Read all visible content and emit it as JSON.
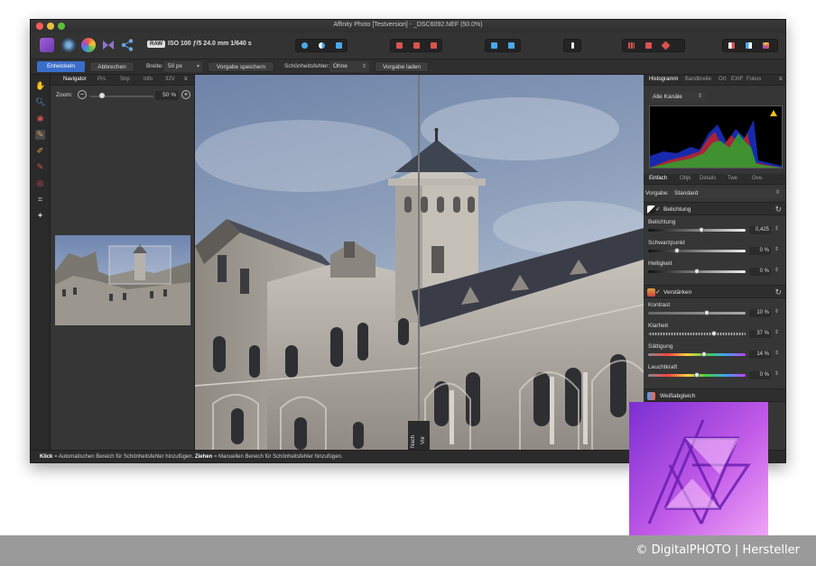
{
  "window": {
    "title": "Affinity Photo [Testversion] - _DSC6092.NEF (50.0%)"
  },
  "toolbar": {
    "raw_badge": "RAW",
    "camera_info": "ISO 100 ƒ/5 24.0 mm 1/640 s"
  },
  "context_bar": {
    "develop_label": "Entwickeln",
    "cancel_label": "Abbrechen",
    "width_label": "Breite:",
    "width_value": "50 px",
    "save_preset_label": "Vorgabe speichern",
    "blemish_label": "Schönheitsfehler:",
    "blemish_value": "Ohne",
    "load_preset_label": "Vorgabe laden"
  },
  "navigator": {
    "tabs": [
      "Navigator",
      "Prs",
      "Snp",
      "Info",
      "32V"
    ],
    "zoom_label": "Zoom:",
    "zoom_value": "50 %",
    "zoom_level": 0.5
  },
  "canvas": {
    "split_after": "Nach",
    "split_before": "Vor"
  },
  "right_panel": {
    "top_tabs": [
      "Histogramm",
      "Bandbreite",
      "Ort",
      "EXIF",
      "Fokus"
    ],
    "channel_select": "Alle Kanäle",
    "adjust_tabs": [
      "Einfach",
      "Objk",
      "Details",
      "Twe",
      "Ove."
    ],
    "preset_label": "Vorgabe:",
    "preset_value": "Standard",
    "sections": [
      {
        "name": "Belichtung",
        "sliders": [
          {
            "label": "Belichtung",
            "value": "0,425",
            "level": 0.55
          },
          {
            "label": "Schwarzpunkt",
            "value": "0 %",
            "level": 0.3
          },
          {
            "label": "Helligkeit",
            "value": "0 %",
            "level": 0.5
          }
        ]
      },
      {
        "name": "Verstärken",
        "sliders": [
          {
            "label": "Kontrast",
            "value": "10 %",
            "level": 0.6
          },
          {
            "label": "Klarheit",
            "value": "37 %",
            "level": 0.68
          },
          {
            "label": "Sättigung",
            "value": "14 %",
            "level": 0.57
          },
          {
            "label": "Leuchtkraft",
            "value": "0 %",
            "level": 0.5
          }
        ]
      },
      {
        "name": "Weißabgleich",
        "sliders": []
      }
    ]
  },
  "status_bar": {
    "click_word": "Klick",
    "click_text": " = Automatischen Bereich für Schönheitsfehler hinzufügen. ",
    "drag_word": "Ziehen",
    "drag_text": " = Manuellen Bereich für Schönheitsfehler hinzufügen."
  },
  "credit": {
    "text": "© DigitalPHOTO | Hersteller"
  },
  "colors": {
    "accent": "#3b6ec9",
    "logo_purple": "#b04fe0",
    "logo_pink": "#e79ef7"
  }
}
